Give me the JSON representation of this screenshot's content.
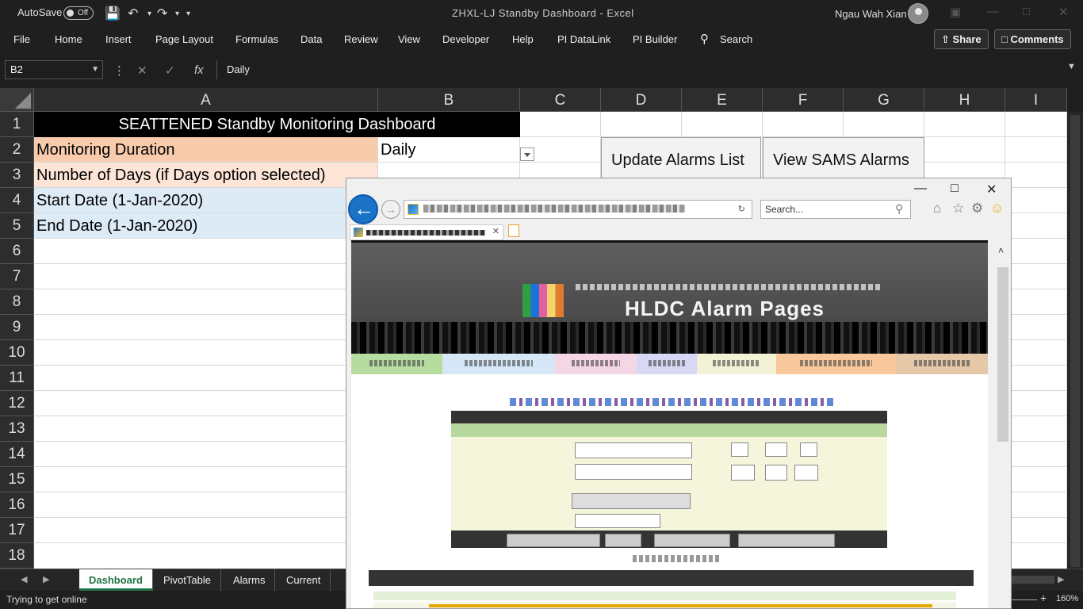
{
  "titlebar": {
    "autosave_label": "AutoSave",
    "autosave_state": "Off",
    "document_title": "ZHXL-LJ Standby Dashboard - Excel",
    "user_name": "Ngau Wah Xian"
  },
  "ribbon": {
    "tabs": [
      "File",
      "Home",
      "Insert",
      "Page Layout",
      "Formulas",
      "Data",
      "Review",
      "View",
      "Developer",
      "Help",
      "PI DataLink",
      "PI Builder"
    ],
    "search_label": "Search",
    "share_label": "Share",
    "comments_label": "Comments"
  },
  "formula_bar": {
    "name_box": "B2",
    "formula": "Daily"
  },
  "grid": {
    "columns": [
      "A",
      "B",
      "C",
      "D",
      "E",
      "F",
      "G",
      "H",
      "I"
    ],
    "rows": [
      "1",
      "2",
      "3",
      "4",
      "5",
      "6",
      "7",
      "8",
      "9",
      "10",
      "11",
      "12",
      "13",
      "14",
      "15",
      "16",
      "17",
      "18"
    ],
    "title": "SEATTENED Standby Monitoring Dashboard",
    "a2": "Monitoring Duration",
    "a3": "Number of Days (if Days option selected)",
    "a4": "Start Date (1-Jan-2020)",
    "a5": "End Date (1-Jan-2020)",
    "b2": "Daily",
    "buttons": {
      "update_alarms": "Update Alarms List",
      "view_alarms": "View SAMS Alarms"
    },
    "colors": {
      "a2_fill": "#f8cbad",
      "a3_fill": "#fce4d6",
      "a4_fill": "#ddebf7"
    }
  },
  "sheets": {
    "tabs": [
      "Dashboard",
      "PivotTable",
      "Alarms",
      "Current"
    ],
    "active": "Dashboard"
  },
  "status": {
    "text": "Trying to get online",
    "zoom": "160%"
  },
  "browser": {
    "search_placeholder": "Search...",
    "banner_title": "HLDC Alarm Pages",
    "nav_colors": [
      "#b6dca0",
      "#d6e8f8",
      "#f4d6e4",
      "#d8d8f4",
      "#f4f2d6",
      "#f8c89c",
      "#e4c8a8"
    ]
  }
}
